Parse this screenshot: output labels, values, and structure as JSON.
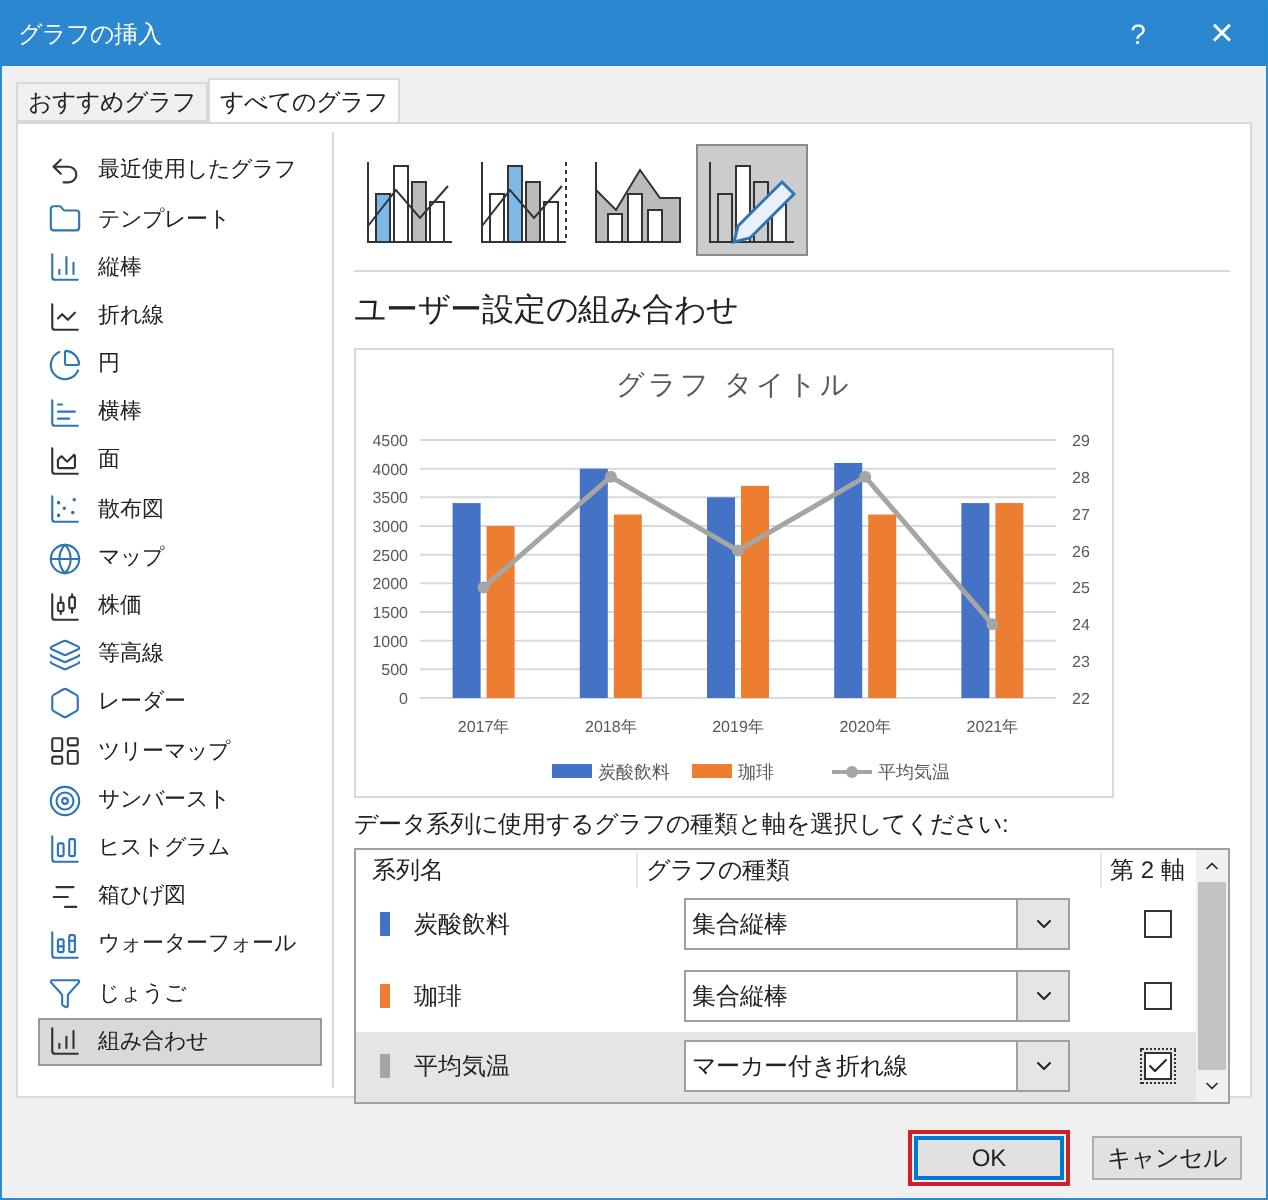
{
  "window": {
    "title": "グラフの挿入",
    "help": "?",
    "close": "×"
  },
  "tabs": [
    {
      "label": "おすすめグラフ",
      "selected": false
    },
    {
      "label": "すべてのグラフ",
      "selected": true
    }
  ],
  "sidebar": {
    "items": [
      {
        "label": "最近使用したグラフ",
        "selected": false
      },
      {
        "label": "テンプレート",
        "selected": false
      },
      {
        "label": "縦棒",
        "selected": false
      },
      {
        "label": "折れ線",
        "selected": false
      },
      {
        "label": "円",
        "selected": false
      },
      {
        "label": "横棒",
        "selected": false
      },
      {
        "label": "面",
        "selected": false
      },
      {
        "label": "散布図",
        "selected": false
      },
      {
        "label": "マップ",
        "selected": false
      },
      {
        "label": "株価",
        "selected": false
      },
      {
        "label": "等高線",
        "selected": false
      },
      {
        "label": "レーダー",
        "selected": false
      },
      {
        "label": "ツリーマップ",
        "selected": false
      },
      {
        "label": "サンバースト",
        "selected": false
      },
      {
        "label": "ヒストグラム",
        "selected": false
      },
      {
        "label": "箱ひげ図",
        "selected": false
      },
      {
        "label": "ウォーターフォール",
        "selected": false
      },
      {
        "label": "じょうご",
        "selected": false
      },
      {
        "label": "組み合わせ",
        "selected": true
      }
    ]
  },
  "subtypes": [
    {
      "selected": false
    },
    {
      "selected": false
    },
    {
      "selected": false
    },
    {
      "selected": true
    }
  ],
  "heading": "ユーザー設定の組み合わせ",
  "preview": {
    "chart_data": {
      "type": "bar",
      "title": "グラフ タイトル",
      "categories": [
        "2017年",
        "2018年",
        "2019年",
        "2020年",
        "2021年"
      ],
      "series": [
        {
          "name": "炭酸飲料",
          "color": "#4472c4",
          "type": "bar",
          "values": [
            3400,
            4000,
            3500,
            4100,
            3400
          ]
        },
        {
          "name": "珈琲",
          "color": "#ed7d31",
          "type": "bar",
          "values": [
            3000,
            3200,
            3700,
            3200,
            3400
          ]
        },
        {
          "name": "平均気温",
          "color": "#a5a5a5",
          "type": "line",
          "axis": "y2",
          "marker": "circle",
          "values": [
            25,
            28,
            26,
            28,
            24
          ]
        }
      ],
      "grid": true,
      "legend": "bottom",
      "ylim": [
        0,
        4500
      ],
      "yticks": [
        0,
        500,
        1000,
        1500,
        2000,
        2500,
        3000,
        3500,
        4000,
        4500
      ],
      "y2lim": [
        22,
        29
      ],
      "y2ticks": [
        22,
        23,
        24,
        25,
        26,
        27,
        28,
        29
      ]
    }
  },
  "instruction": "データ系列に使用するグラフの種類と軸を選択してください:",
  "table": {
    "columns": [
      "系列名",
      "グラフの種類",
      "第 2 軸"
    ],
    "rows": [
      {
        "name": "炭酸飲料",
        "color": "#4472c4",
        "chart_type": "集合縦棒",
        "checked": false,
        "selected": false
      },
      {
        "name": "珈琲",
        "color": "#ed7d31",
        "chart_type": "集合縦棒",
        "checked": false,
        "selected": false
      },
      {
        "name": "平均気温",
        "color": "#a5a5a5",
        "chart_type": "マーカー付き折れ線",
        "checked": true,
        "selected": true
      }
    ]
  },
  "buttons": [
    {
      "label": "OK",
      "default": true
    },
    {
      "label": "キャンセル",
      "default": false
    }
  ]
}
